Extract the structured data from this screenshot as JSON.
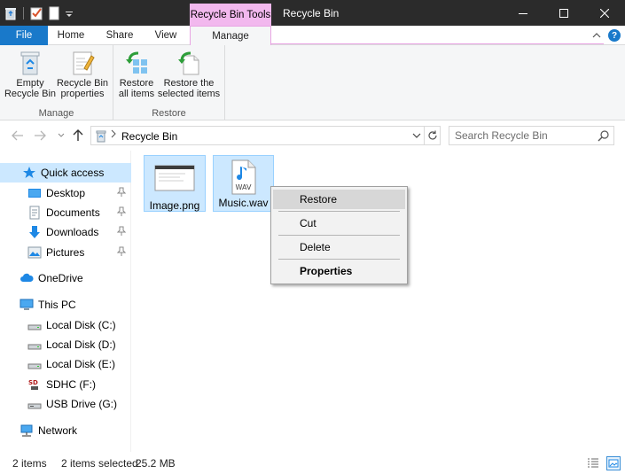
{
  "window": {
    "title": "Recycle Bin",
    "context_tab_group": "Recycle Bin Tools"
  },
  "ribbon": {
    "tabs": [
      {
        "label": "File"
      },
      {
        "label": "Home"
      },
      {
        "label": "Share"
      },
      {
        "label": "View"
      },
      {
        "label": "Manage"
      }
    ],
    "groups": {
      "manage": {
        "label": "Manage",
        "buttons": [
          {
            "label_line1": "Empty",
            "label_line2": "Recycle Bin"
          },
          {
            "label_line1": "Recycle Bin",
            "label_line2": "properties"
          }
        ]
      },
      "restore": {
        "label": "Restore",
        "buttons": [
          {
            "label_line1": "Restore",
            "label_line2": "all items"
          },
          {
            "label_line1": "Restore the",
            "label_line2": "selected items"
          }
        ]
      }
    }
  },
  "address": {
    "path": "Recycle Bin",
    "search_placeholder": "Search Recycle Bin"
  },
  "navpane": {
    "items": [
      {
        "label": "Quick access"
      },
      {
        "label": "Desktop"
      },
      {
        "label": "Documents"
      },
      {
        "label": "Downloads"
      },
      {
        "label": "Pictures"
      },
      {
        "label": "OneDrive"
      },
      {
        "label": "This PC"
      },
      {
        "label": "Local Disk (C:)"
      },
      {
        "label": "Local Disk (D:)"
      },
      {
        "label": "Local Disk (E:)"
      },
      {
        "label": "SDHC (F:)"
      },
      {
        "label": "USB Drive (G:)"
      },
      {
        "label": "Network"
      }
    ]
  },
  "files": [
    {
      "name": "Image.png"
    },
    {
      "name": "Music.wav",
      "badge": "WAV"
    }
  ],
  "context_menu": {
    "items": [
      {
        "label": "Restore"
      },
      {
        "label": "Cut"
      },
      {
        "label": "Delete"
      },
      {
        "label": "Properties"
      }
    ]
  },
  "status": {
    "count": "2 items",
    "selected": "2 items selected",
    "size": "25.2 MB"
  },
  "colors": {
    "accent": "#1979ca",
    "selection": "#cce8ff",
    "context_tab": "#f2b8ee",
    "titlebar": "#2b2b2b"
  }
}
